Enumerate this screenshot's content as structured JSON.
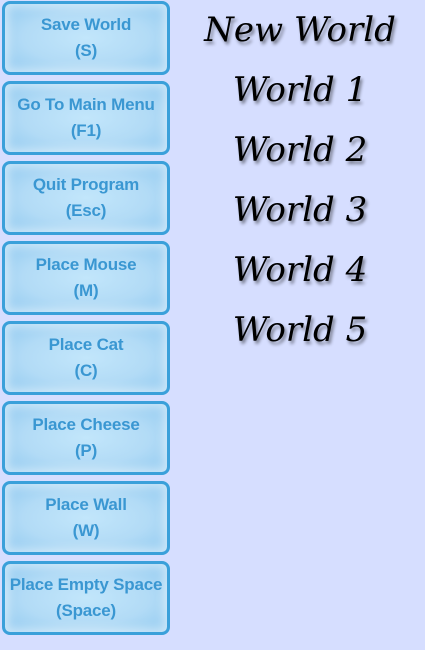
{
  "buttons": [
    {
      "label": "Save World",
      "key": "(S)"
    },
    {
      "label": "Go To Main Menu",
      "key": "(F1)"
    },
    {
      "label": "Quit Program",
      "key": "(Esc)"
    },
    {
      "label": "Place Mouse",
      "key": "(M)"
    },
    {
      "label": "Place Cat",
      "key": "(C)"
    },
    {
      "label": "Place Cheese",
      "key": "(P)"
    },
    {
      "label": "Place Wall",
      "key": "(W)"
    },
    {
      "label": "Place Empty Space",
      "key": "(Space)"
    }
  ],
  "worlds": [
    "New World",
    "World 1",
    "World 2",
    "World 3",
    "World 4",
    "World 5"
  ]
}
